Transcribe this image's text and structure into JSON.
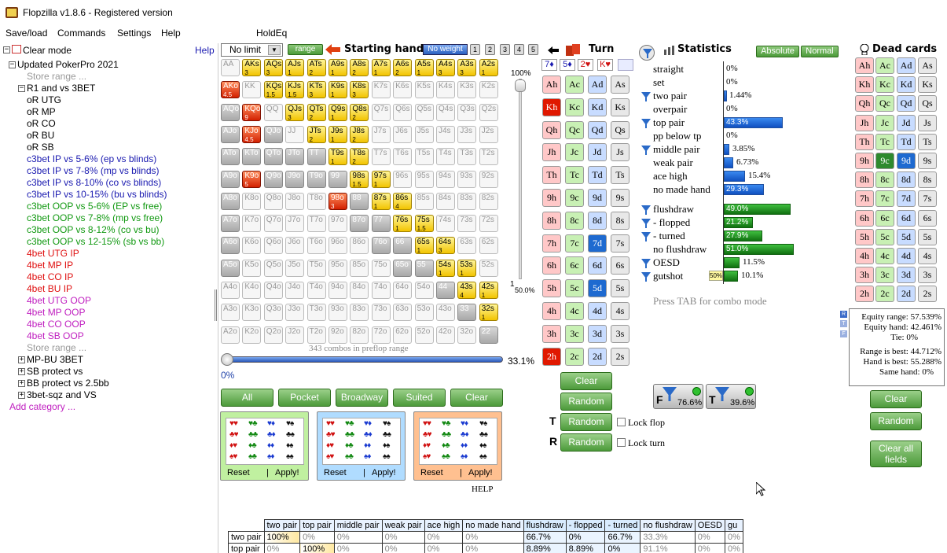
{
  "window": {
    "title": "Flopzilla v1.8.6 - Registered version"
  },
  "menu": [
    "Save/load",
    "Commands",
    "Settings",
    "Help",
    "HoldEq"
  ],
  "tree": {
    "clear_mode": "Clear mode",
    "help": "Help",
    "root": "Updated PokerPro 2021",
    "store_range": "Store range ...",
    "r1": "R1 and vs 3BET",
    "items": [
      {
        "t": "oR UTG",
        "c": "#000"
      },
      {
        "t": "oR MP",
        "c": "#000"
      },
      {
        "t": "oR CO",
        "c": "#000"
      },
      {
        "t": "oR BU",
        "c": "#000"
      },
      {
        "t": "oR SB",
        "c": "#000"
      },
      {
        "t": "c3bet IP vs 5-6% (ep vs blinds)",
        "c": "#1a1ab0"
      },
      {
        "t": "c3bet IP vs 7-8% (mp vs blinds)",
        "c": "#1a1ab0"
      },
      {
        "t": "c3bet IP vs 8-10% (co vs blinds)",
        "c": "#1a1ab0"
      },
      {
        "t": "c3bet IP vs 10-15% (bu vs blinds)",
        "c": "#1a1ab0"
      },
      {
        "t": "c3bet OOP vs 5-6% (EP vs free)",
        "c": "#119911"
      },
      {
        "t": "c3bet OOP vs 7-8% (mp vs free)",
        "c": "#119911"
      },
      {
        "t": "c3bet OOP vs 8-12% (co vs bu)",
        "c": "#119911"
      },
      {
        "t": "c3bet OOP vs 12-15% (sb vs bb)",
        "c": "#119911"
      },
      {
        "t": "4bet UTG IP",
        "c": "#e01010"
      },
      {
        "t": "4bet MP IP",
        "c": "#e01010"
      },
      {
        "t": "4bet CO IP",
        "c": "#e01010"
      },
      {
        "t": "4bet BU IP",
        "c": "#e01010"
      },
      {
        "t": "4bet UTG OOP",
        "c": "#c020c0"
      },
      {
        "t": "4bet MP OOP",
        "c": "#c020c0"
      },
      {
        "t": "4bet CO OOP",
        "c": "#c020c0"
      },
      {
        "t": "4bet SB OOP",
        "c": "#c020c0"
      }
    ],
    "store_range2": "Store range ...",
    "cats": [
      "MP-BU 3BET",
      "SB protect vs",
      "BB protect vs 2.5bb",
      "3bet-sqz and VS"
    ],
    "add": "Add category ..."
  },
  "range": {
    "limit": "No limit",
    "range_btn": "range",
    "starting_hand": "Starting hand",
    "no_weight": "No weight",
    "weights": [
      "1",
      "2",
      "3",
      "4",
      "5"
    ],
    "slider_top": "100%",
    "slider_mid": "1",
    "slider_low": "50.0%",
    "combos": "343 combos in preflop range",
    "h_left": "0%",
    "h_right": "33.1%",
    "buttons": [
      "All",
      "Pocket",
      "Broadway",
      "Suited",
      "Clear"
    ],
    "reset": "Reset",
    "apply": "Apply!",
    "help": "HELP"
  },
  "grid": [
    [
      "AA",
      "",
      "n"
    ],
    [
      "AKs",
      "3",
      "g"
    ],
    [
      "AQs",
      "3",
      "g"
    ],
    [
      "AJs",
      "1",
      "g"
    ],
    [
      "ATs",
      "2",
      "g"
    ],
    [
      "A9s",
      "1",
      "g"
    ],
    [
      "A8s",
      "2",
      "g"
    ],
    [
      "A7s",
      "1",
      "g"
    ],
    [
      "A6s",
      "2",
      "g"
    ],
    [
      "A5s",
      "1",
      "g"
    ],
    [
      "A4s",
      "3",
      "g"
    ],
    [
      "A3s",
      "3",
      "g"
    ],
    [
      "A2s",
      "1",
      "g"
    ],
    [
      "AKo",
      "4.5",
      "r"
    ],
    [
      "KK",
      "",
      "n"
    ],
    [
      "KQs",
      "1.5",
      "g"
    ],
    [
      "KJs",
      "1.5",
      "g"
    ],
    [
      "KTs",
      "3",
      "g"
    ],
    [
      "K9s",
      "1",
      "g"
    ],
    [
      "K8s",
      "3",
      "g"
    ],
    [
      "K7s",
      "",
      "n"
    ],
    [
      "K6s",
      "",
      "n"
    ],
    [
      "K5s",
      "",
      "n"
    ],
    [
      "K4s",
      "",
      "n"
    ],
    [
      "K3s",
      "",
      "n"
    ],
    [
      "K2s",
      "",
      "n"
    ],
    [
      "AQo",
      "",
      "y"
    ],
    [
      "KQo",
      "9",
      "r"
    ],
    [
      "QQ",
      "",
      "n"
    ],
    [
      "QJs",
      "3",
      "g"
    ],
    [
      "QTs",
      "2",
      "g"
    ],
    [
      "Q9s",
      "1",
      "g"
    ],
    [
      "Q8s",
      "2",
      "g"
    ],
    [
      "Q7s",
      "",
      "n"
    ],
    [
      "Q6s",
      "",
      "n"
    ],
    [
      "Q5s",
      "",
      "n"
    ],
    [
      "Q4s",
      "",
      "n"
    ],
    [
      "Q3s",
      "",
      "n"
    ],
    [
      "Q2s",
      "",
      "n"
    ],
    [
      "AJo",
      "",
      "y"
    ],
    [
      "KJo",
      "4.5",
      "r"
    ],
    [
      "QJo",
      "",
      "y"
    ],
    [
      "JJ",
      "",
      "n"
    ],
    [
      "JTs",
      "2",
      "g"
    ],
    [
      "J9s",
      "1",
      "g"
    ],
    [
      "J8s",
      "2",
      "g"
    ],
    [
      "J7s",
      "",
      "n"
    ],
    [
      "J6s",
      "",
      "n"
    ],
    [
      "J5s",
      "",
      "n"
    ],
    [
      "J4s",
      "",
      "n"
    ],
    [
      "J3s",
      "",
      "n"
    ],
    [
      "J2s",
      "",
      "n"
    ],
    [
      "ATo",
      "",
      "y"
    ],
    [
      "KTo",
      "",
      "y"
    ],
    [
      "QTo",
      "",
      "y"
    ],
    [
      "JTo",
      "",
      "y"
    ],
    [
      "TT",
      "",
      "y"
    ],
    [
      "T9s",
      "1",
      "g"
    ],
    [
      "T8s",
      "2",
      "g"
    ],
    [
      "T7s",
      "",
      "n"
    ],
    [
      "T6s",
      "",
      "n"
    ],
    [
      "T5s",
      "",
      "n"
    ],
    [
      "T4s",
      "",
      "n"
    ],
    [
      "T3s",
      "",
      "n"
    ],
    [
      "T2s",
      "",
      "n"
    ],
    [
      "A9o",
      "",
      "y"
    ],
    [
      "K9o",
      "5",
      "r"
    ],
    [
      "Q9o",
      "",
      "y"
    ],
    [
      "J9o",
      "",
      "y"
    ],
    [
      "T9o",
      "",
      "y"
    ],
    [
      "99",
      "",
      "y"
    ],
    [
      "98s",
      "1.5",
      "g"
    ],
    [
      "97s",
      "1",
      "g"
    ],
    [
      "96s",
      "",
      "n"
    ],
    [
      "95s",
      "",
      "n"
    ],
    [
      "94s",
      "",
      "n"
    ],
    [
      "93s",
      "",
      "n"
    ],
    [
      "92s",
      "",
      "n"
    ],
    [
      "A8o",
      "",
      "y"
    ],
    [
      "K8o",
      "",
      "n"
    ],
    [
      "Q8o",
      "",
      "n"
    ],
    [
      "J8o",
      "",
      "n"
    ],
    [
      "T8o",
      "",
      "n"
    ],
    [
      "98o",
      "3",
      "r"
    ],
    [
      "88",
      "",
      "y"
    ],
    [
      "87s",
      "1",
      "g"
    ],
    [
      "86s",
      "4",
      "g"
    ],
    [
      "85s",
      "",
      "n"
    ],
    [
      "84s",
      "",
      "n"
    ],
    [
      "83s",
      "",
      "n"
    ],
    [
      "82s",
      "",
      "n"
    ],
    [
      "A7o",
      "",
      "y"
    ],
    [
      "K7o",
      "",
      "n"
    ],
    [
      "Q7o",
      "",
      "n"
    ],
    [
      "J7o",
      "",
      "n"
    ],
    [
      "T7o",
      "",
      "n"
    ],
    [
      "97o",
      "",
      "n"
    ],
    [
      "87o",
      "",
      "y"
    ],
    [
      "77",
      "",
      "y"
    ],
    [
      "76s",
      "1",
      "g"
    ],
    [
      "75s",
      "1.5",
      "g"
    ],
    [
      "74s",
      "",
      "n"
    ],
    [
      "73s",
      "",
      "n"
    ],
    [
      "72s",
      "",
      "n"
    ],
    [
      "A6o",
      "",
      "y"
    ],
    [
      "K6o",
      "",
      "n"
    ],
    [
      "Q6o",
      "",
      "n"
    ],
    [
      "J6o",
      "",
      "n"
    ],
    [
      "T6o",
      "",
      "n"
    ],
    [
      "96o",
      "",
      "n"
    ],
    [
      "86o",
      "",
      "n"
    ],
    [
      "76o",
      "",
      "y"
    ],
    [
      "66",
      "",
      "y"
    ],
    [
      "65s",
      "1",
      "g"
    ],
    [
      "64s",
      "3",
      "g"
    ],
    [
      "63s",
      "",
      "n"
    ],
    [
      "62s",
      "",
      "n"
    ],
    [
      "A5o",
      "",
      "y"
    ],
    [
      "K5o",
      "",
      "n"
    ],
    [
      "Q5o",
      "",
      "n"
    ],
    [
      "J5o",
      "",
      "n"
    ],
    [
      "T5o",
      "",
      "n"
    ],
    [
      "95o",
      "",
      "n"
    ],
    [
      "85o",
      "",
      "n"
    ],
    [
      "75o",
      "",
      "n"
    ],
    [
      "65o",
      "",
      "y"
    ],
    [
      "55",
      "",
      "y"
    ],
    [
      "54s",
      "1",
      "g"
    ],
    [
      "53s",
      "1",
      "g"
    ],
    [
      "52s",
      "",
      "n"
    ],
    [
      "A4o",
      "",
      "n"
    ],
    [
      "K4o",
      "",
      "n"
    ],
    [
      "Q4o",
      "",
      "n"
    ],
    [
      "J4o",
      "",
      "n"
    ],
    [
      "T4o",
      "",
      "n"
    ],
    [
      "94o",
      "",
      "n"
    ],
    [
      "84o",
      "",
      "n"
    ],
    [
      "74o",
      "",
      "n"
    ],
    [
      "64o",
      "",
      "n"
    ],
    [
      "54o",
      "",
      "n"
    ],
    [
      "44",
      "",
      "y"
    ],
    [
      "43s",
      "4",
      "g"
    ],
    [
      "42s",
      "1",
      "g"
    ],
    [
      "A3o",
      "",
      "n"
    ],
    [
      "K3o",
      "",
      "n"
    ],
    [
      "Q3o",
      "",
      "n"
    ],
    [
      "J3o",
      "",
      "n"
    ],
    [
      "T3o",
      "",
      "n"
    ],
    [
      "93o",
      "",
      "n"
    ],
    [
      "83o",
      "",
      "n"
    ],
    [
      "73o",
      "",
      "n"
    ],
    [
      "63o",
      "",
      "n"
    ],
    [
      "53o",
      "",
      "n"
    ],
    [
      "43o",
      "",
      "n"
    ],
    [
      "33",
      "",
      "y"
    ],
    [
      "32s",
      "1",
      "g"
    ],
    [
      "A2o",
      "",
      "n"
    ],
    [
      "K2o",
      "",
      "n"
    ],
    [
      "Q2o",
      "",
      "n"
    ],
    [
      "J2o",
      "",
      "n"
    ],
    [
      "T2o",
      "",
      "n"
    ],
    [
      "92o",
      "",
      "n"
    ],
    [
      "82o",
      "",
      "n"
    ],
    [
      "72o",
      "",
      "n"
    ],
    [
      "62o",
      "",
      "n"
    ],
    [
      "52o",
      "",
      "n"
    ],
    [
      "42o",
      "",
      "n"
    ],
    [
      "32o",
      "",
      "n"
    ],
    [
      "22",
      "",
      "y"
    ]
  ],
  "board": {
    "turn": "Turn",
    "flop_cards": [
      "7♦",
      "5♦",
      "2♥",
      "K♥"
    ],
    "ranks": [
      "A",
      "K",
      "Q",
      "J",
      "T",
      "9",
      "8",
      "7",
      "6",
      "5",
      "4",
      "3",
      "2"
    ],
    "clear": "Clear",
    "random": "Random",
    "lock_flop": "Lock flop",
    "lock_turn": "Lock turn"
  },
  "stats": {
    "title": "Statistics",
    "absolute": "Absolute",
    "normal": "Normal",
    "rows": [
      {
        "l": "straight",
        "v": "0%",
        "b": 0,
        "t": "blue",
        "f": false
      },
      {
        "l": "set",
        "v": "0%",
        "b": 0,
        "t": "blue",
        "f": false
      },
      {
        "l": "two pair",
        "v": "1.44%",
        "b": 0.0144,
        "t": "blue",
        "f": true
      },
      {
        "l": "overpair",
        "v": "0%",
        "b": 0,
        "t": "blue",
        "f": false
      },
      {
        "l": "top pair",
        "v": "43.3%",
        "b": 0.433,
        "t": "blue",
        "f": true
      },
      {
        "l": "pp below tp",
        "v": "0%",
        "b": 0,
        "t": "blue",
        "f": false
      },
      {
        "l": "middle pair",
        "v": "3.85%",
        "b": 0.0385,
        "t": "blue",
        "f": true
      },
      {
        "l": "weak pair",
        "v": "6.73%",
        "b": 0.0673,
        "t": "blue",
        "f": false
      },
      {
        "l": "ace high",
        "v": "15.4%",
        "b": 0.154,
        "t": "blue",
        "f": false
      },
      {
        "l": "no made hand",
        "v": "29.3%",
        "b": 0.293,
        "t": "blue",
        "f": false
      },
      {
        "l": "flushdraw",
        "v": "49.0%",
        "b": 0.49,
        "t": "green",
        "f": true
      },
      {
        "l": "- flopped",
        "v": "21.2%",
        "b": 0.212,
        "t": "green",
        "f": true
      },
      {
        "l": "- turned",
        "v": "27.9%",
        "b": 0.279,
        "t": "green",
        "f": true
      },
      {
        "l": "no flushdraw",
        "v": "51.0%",
        "b": 0.51,
        "t": "green",
        "f": false
      },
      {
        "l": "OESD",
        "v": "11.5%",
        "b": 0.115,
        "t": "green",
        "f": true
      },
      {
        "l": "gutshot",
        "v": "10.1%",
        "b": 0.101,
        "t": "green",
        "f": true
      }
    ],
    "gut_tag": "50%",
    "press_tab": "Press TAB for combo mode",
    "filter_f": "76.6%",
    "filter_t": "39.6%"
  },
  "dead": {
    "title": "Dead cards",
    "clear": "Clear",
    "random": "Random",
    "clear_all": "Clear all fields",
    "equity": [
      "Equity range: 57.539%",
      "Equity hand: 42.461%",
      "Tie: 0%"
    ],
    "best": [
      "Range is best: 44.712%",
      "Hand is best: 55.288%",
      "Same hand: 0%"
    ]
  },
  "table": {
    "headers": [
      "",
      "two pair",
      "top pair",
      "middle pair",
      "weak pair",
      "ace high",
      "no made hand",
      "flushdraw",
      "- flopped",
      "- turned",
      "no flushdraw",
      "OESD",
      "gu"
    ],
    "rows": [
      [
        "two pair",
        "100%",
        "0%",
        "0%",
        "0%",
        "0%",
        "0%",
        "66.7%",
        "0%",
        "66.7%",
        "33.3%",
        "0%",
        "0%"
      ],
      [
        "top pair",
        "0%",
        "100%",
        "0%",
        "0%",
        "0%",
        "0%",
        "8.89%",
        "8.89%",
        "0%",
        "91.1%",
        "0%",
        "0%"
      ]
    ]
  }
}
